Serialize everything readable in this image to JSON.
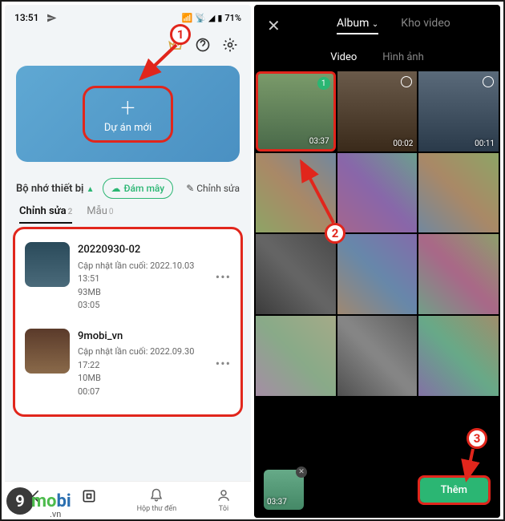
{
  "status": {
    "time": "13:51",
    "battery": "71%"
  },
  "hero": {
    "label": "Dự án mới"
  },
  "storage": {
    "label": "Bộ nhớ thiết bị",
    "cloud": "Đám mây",
    "edit": "Chỉnh sửa"
  },
  "ltabs": {
    "edit": "Chỉnh sửa",
    "edit_n": "2",
    "tmpl": "Mẫu",
    "tmpl_n": "0"
  },
  "projects": [
    {
      "title": "20220930-02",
      "updated": "Cập nhật lần cuối: 2022.10.03 13:51",
      "size": "93MB",
      "dur": "03:05"
    },
    {
      "title": "9mobi_vn",
      "updated": "Cập nhật lần cuối: 2022.09.30 17:22",
      "size": "10MB",
      "dur": "00:07"
    }
  ],
  "bottom": {
    "edit": "",
    "inbox": "Hộp thư đến",
    "me": "Tôi"
  },
  "r_top": {
    "album": "Album",
    "store": "Kho video"
  },
  "r_sub": {
    "video": "Video",
    "image": "Hình ảnh"
  },
  "cells": [
    {
      "dur": "03:37",
      "sel": true
    },
    {
      "dur": "00:02"
    },
    {
      "dur": "00:11"
    }
  ],
  "mini_dur": "03:37",
  "add": "Thêm",
  "callouts": {
    "c1": "1",
    "c2": "2",
    "c3": "3"
  },
  "brand": {
    "nine": "9",
    "mobi": "mobi",
    "vn": ".vn"
  }
}
